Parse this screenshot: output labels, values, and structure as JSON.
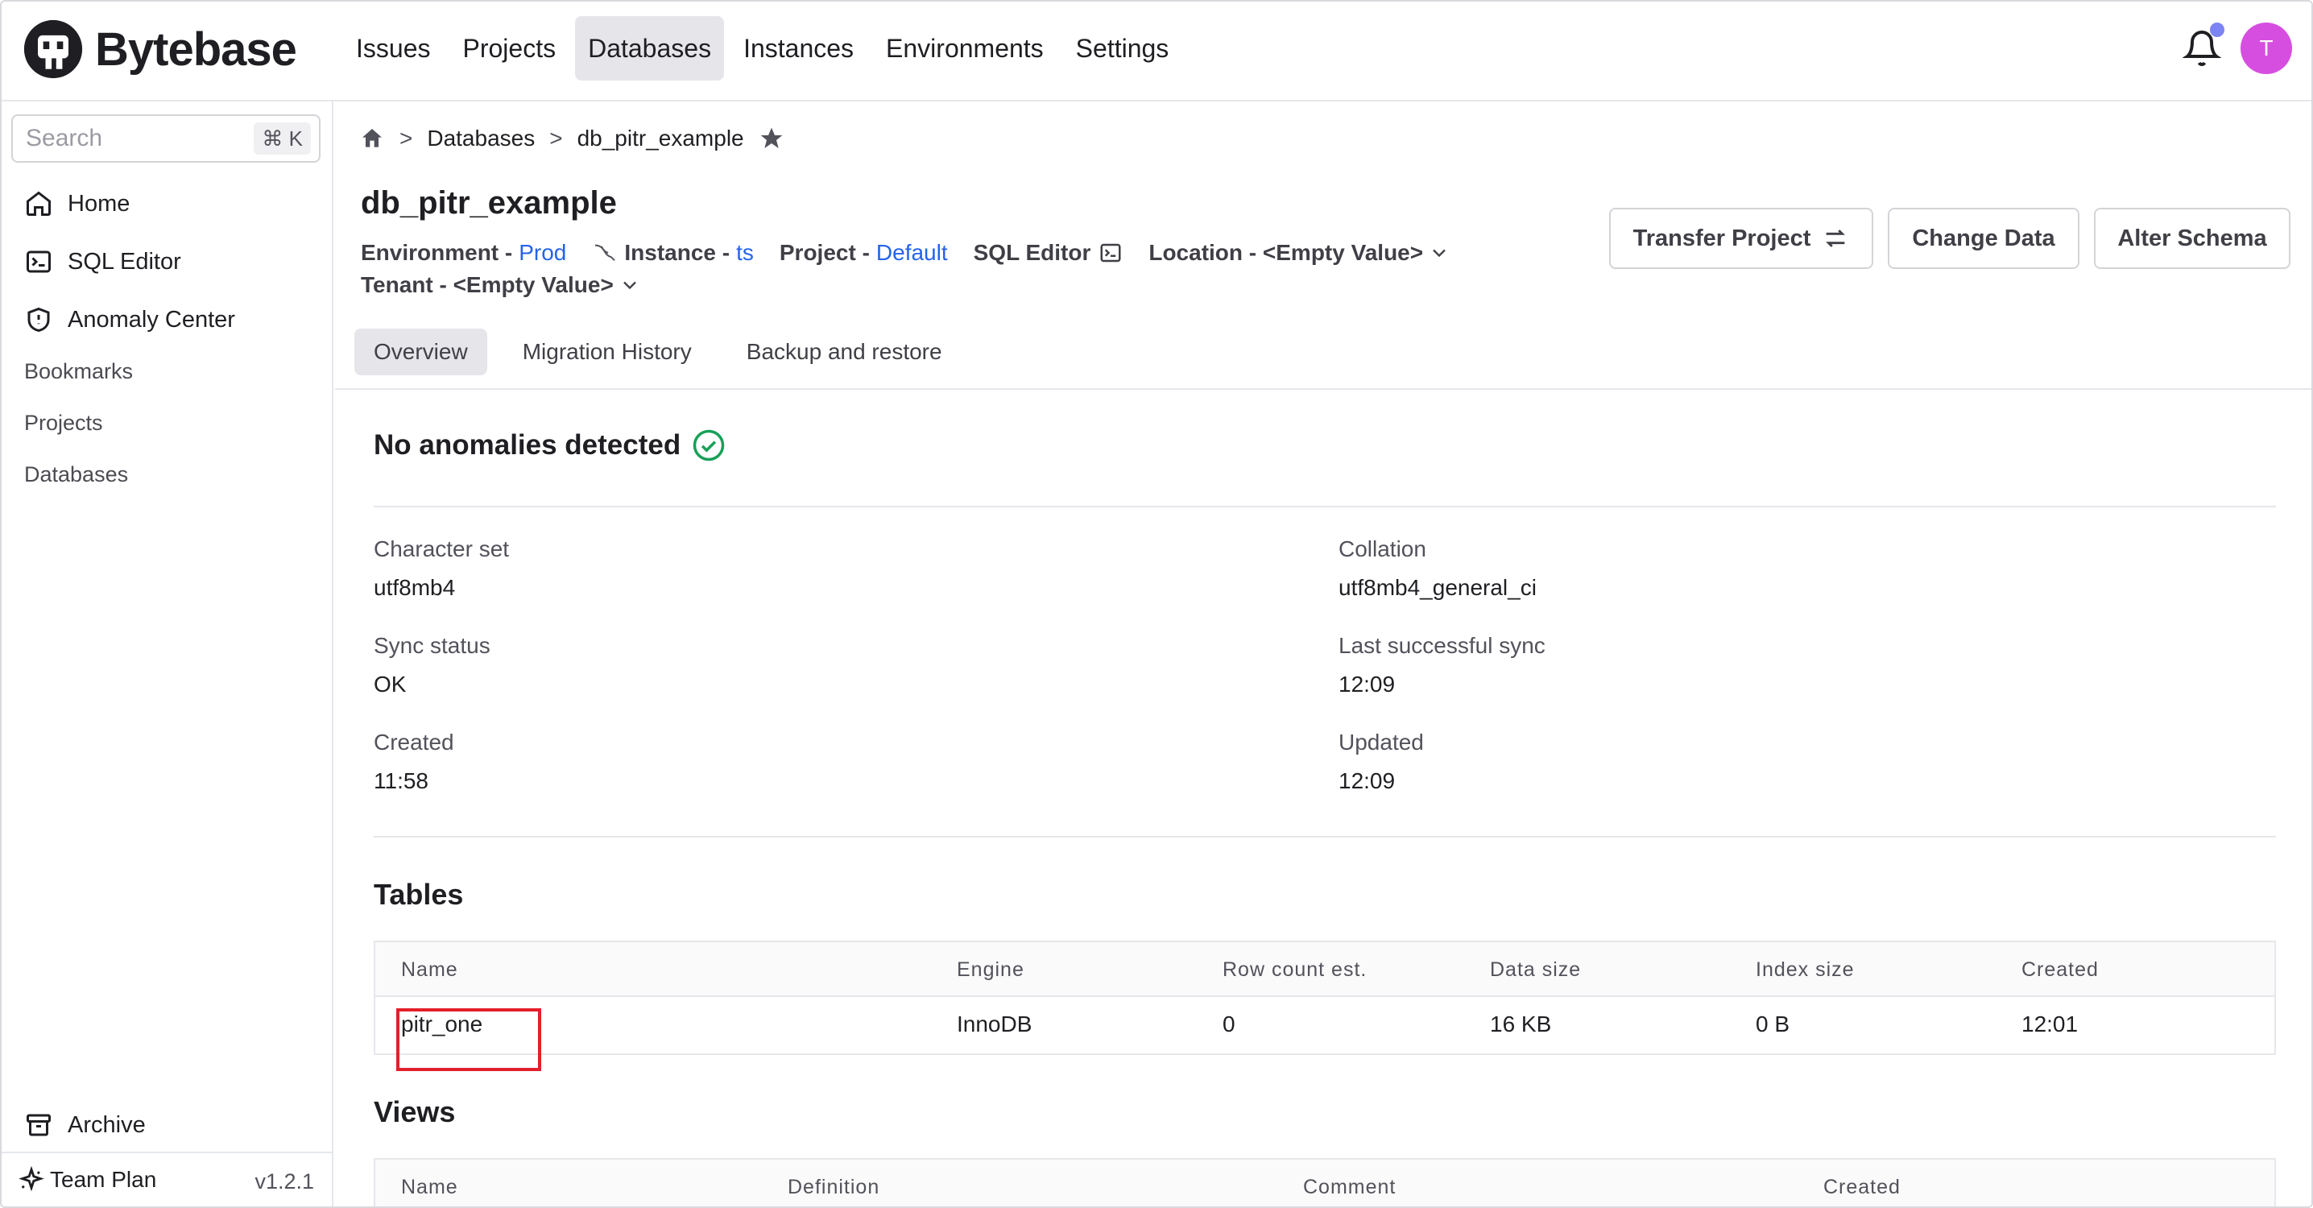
{
  "app": {
    "brand": "Bytebase",
    "colors": {
      "accent": "#2563eb",
      "avatar": "#d64ee0",
      "highlight": "#e2202b"
    }
  },
  "nav": {
    "items": [
      "Issues",
      "Projects",
      "Databases",
      "Instances",
      "Environments",
      "Settings"
    ],
    "active": "Databases"
  },
  "user": {
    "avatar_initial": "T"
  },
  "sidebar": {
    "search_placeholder": "Search",
    "search_shortcut": "⌘ K",
    "items": [
      {
        "label": "Home",
        "icon": "home-icon"
      },
      {
        "label": "SQL Editor",
        "icon": "terminal-icon"
      },
      {
        "label": "Anomaly Center",
        "icon": "shield-icon"
      }
    ],
    "links": [
      "Bookmarks",
      "Projects",
      "Databases"
    ],
    "archive": "Archive",
    "plan": "Team Plan",
    "version": "v1.2.1"
  },
  "breadcrumb": {
    "databases": "Databases",
    "current": "db_pitr_example",
    "sep": ">"
  },
  "database": {
    "title": "db_pitr_example",
    "environment_label": "Environment -",
    "environment_value": "Prod",
    "instance_label": "Instance -",
    "instance_value": "ts",
    "project_label": "Project -",
    "project_value": "Default",
    "sql_editor_label": "SQL Editor",
    "location_label": "Location - <Empty Value>",
    "tenant_label": "Tenant - <Empty Value>"
  },
  "actions": {
    "transfer": "Transfer Project",
    "change_data": "Change Data",
    "alter_schema": "Alter Schema"
  },
  "tabs": [
    "Overview",
    "Migration History",
    "Backup and restore"
  ],
  "overview": {
    "anomaly_text": "No anomalies detected",
    "fields": {
      "charset_label": "Character set",
      "charset_value": "utf8mb4",
      "collation_label": "Collation",
      "collation_value": "utf8mb4_general_ci",
      "sync_label": "Sync status",
      "sync_value": "OK",
      "last_sync_label": "Last successful sync",
      "last_sync_value": "12:09",
      "created_label": "Created",
      "created_value": "11:58",
      "updated_label": "Updated",
      "updated_value": "12:09"
    }
  },
  "tables": {
    "title": "Tables",
    "columns": [
      "Name",
      "Engine",
      "Row count est.",
      "Data size",
      "Index size",
      "Created"
    ],
    "rows": [
      {
        "name": "pitr_one",
        "engine": "InnoDB",
        "rows": "0",
        "data_size": "16 KB",
        "index_size": "0 B",
        "created": "12:01"
      }
    ]
  },
  "views": {
    "title": "Views",
    "columns": [
      "Name",
      "Definition",
      "Comment",
      "Created"
    ]
  }
}
